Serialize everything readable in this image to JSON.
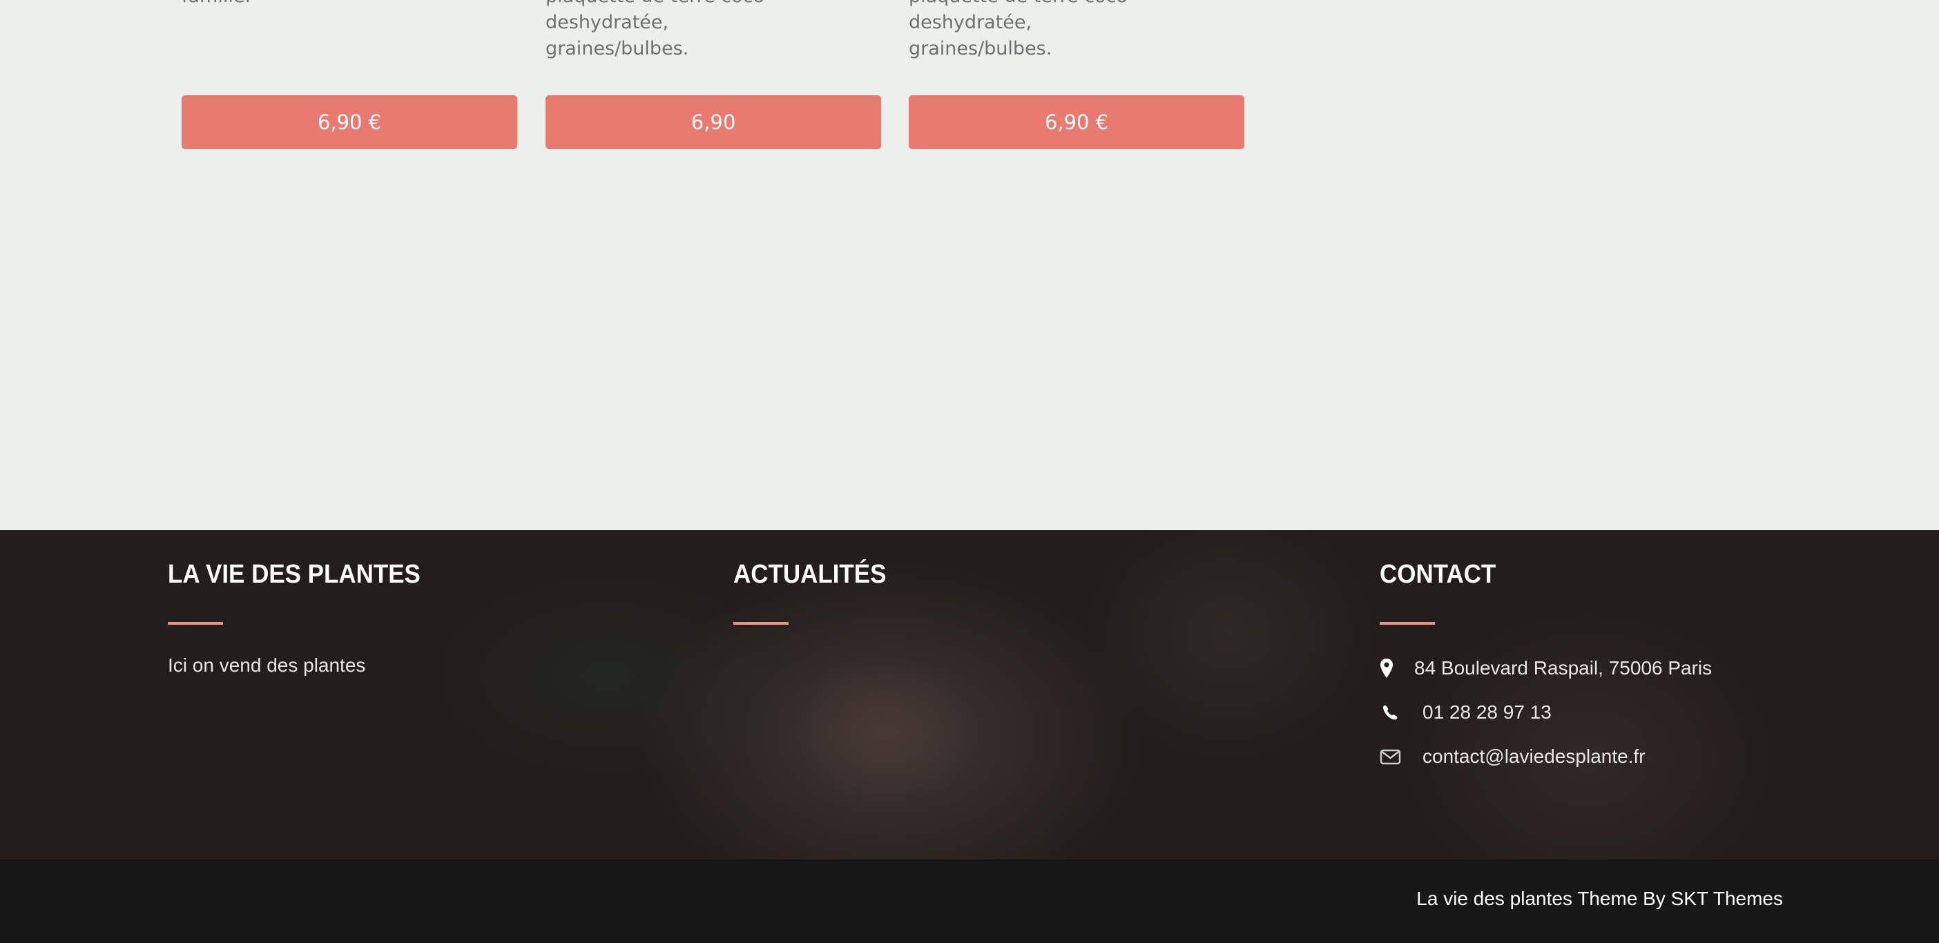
{
  "products": {
    "items": [
      {
        "description": "famille.",
        "price": "6,90 €"
      },
      {
        "description": "plaquette de terre coco deshydratée,\ngraines/bulbes.",
        "price": "6,90"
      },
      {
        "description": "plaquette de terre coco deshydratée,\ngraines/bulbes.",
        "price": "6,90 €"
      }
    ]
  },
  "footer": {
    "about": {
      "heading": "LA VIE DES PLANTES",
      "text": "Ici on vend des plantes"
    },
    "news": {
      "heading": "ACTUALITÉS"
    },
    "contact": {
      "heading": "CONTACT",
      "address": "84 Boulevard Raspail, 75006 Paris",
      "phone": "01 28 28 97 13",
      "email": "contact@laviedesplante.fr"
    },
    "accent_color": "#e8937f"
  },
  "bottom_bar": {
    "credits": "La vie des plantes Theme By SKT Themes"
  },
  "colors": {
    "button": "#e97a6f",
    "page_background": "#ecf0ec",
    "footer_background": "#231d1b",
    "bottom_bar_background": "#171717"
  }
}
